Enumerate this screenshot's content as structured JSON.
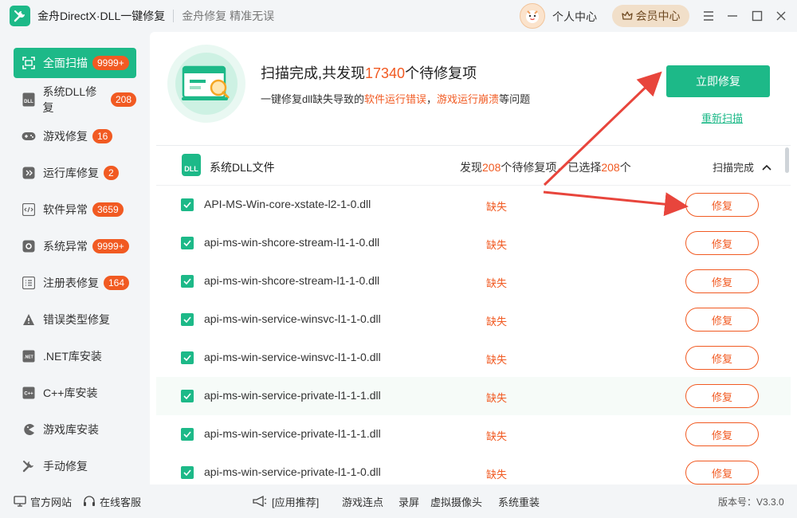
{
  "titlebar": {
    "app_name": "金舟DirectX·DLL一键修复",
    "slogan": "金舟修复 精准无误",
    "personal_center": "个人中心",
    "vip_center": "会员中心"
  },
  "sidebar": {
    "items": [
      {
        "label": "全面扫描",
        "badge": "9999+",
        "icon": "scan-icon",
        "active": true
      },
      {
        "label": "系统DLL修复",
        "badge": "208",
        "icon": "dll-icon"
      },
      {
        "label": "游戏修复",
        "badge": "16",
        "icon": "gamepad-icon"
      },
      {
        "label": "运行库修复",
        "badge": "2",
        "icon": "runtime-icon"
      },
      {
        "label": "软件异常",
        "badge": "3659",
        "icon": "code-icon"
      },
      {
        "label": "系统异常",
        "badge": "9999+",
        "icon": "gear-icon"
      },
      {
        "label": "注册表修复",
        "badge": "164",
        "icon": "list-icon"
      },
      {
        "label": "错误类型修复",
        "badge": "",
        "icon": "warning-icon"
      },
      {
        "label": ".NET库安装",
        "badge": "",
        "icon": "dotnet-icon"
      },
      {
        "label": "C++库安装",
        "badge": "",
        "icon": "cpp-icon"
      },
      {
        "label": "游戏库安装",
        "badge": "",
        "icon": "pacman-icon"
      },
      {
        "label": "手动修复",
        "badge": "",
        "icon": "wrench-icon"
      }
    ]
  },
  "hero": {
    "title_prefix": "扫描完成,共发现",
    "count": "17340",
    "title_suffix": "个待修复项",
    "sub_prefix": "一键修复dll缺失导致的",
    "sub_hl1": "软件运行错误",
    "sub_sep": "，",
    "sub_hl2": "游戏运行崩溃",
    "sub_suffix": "等问题",
    "fix_now": "立即修复",
    "rescan": "重新扫描"
  },
  "list": {
    "title": "系统DLL文件",
    "dll_icon_text": "DLL",
    "found_prefix": "发现",
    "found_count": "208",
    "found_mid": "个待修复项，已选择",
    "selected_count": "208",
    "found_suffix": "个",
    "scan_status": "扫描完成",
    "rows": [
      {
        "name": "API-MS-Win-core-xstate-l2-1-0.dll",
        "status": "缺失",
        "action": "修复"
      },
      {
        "name": "api-ms-win-shcore-stream-l1-1-0.dll",
        "status": "缺失",
        "action": "修复"
      },
      {
        "name": "api-ms-win-shcore-stream-l1-1-0.dll",
        "status": "缺失",
        "action": "修复"
      },
      {
        "name": "api-ms-win-service-winsvc-l1-1-0.dll",
        "status": "缺失",
        "action": "修复"
      },
      {
        "name": "api-ms-win-service-winsvc-l1-1-0.dll",
        "status": "缺失",
        "action": "修复"
      },
      {
        "name": "api-ms-win-service-private-l1-1-1.dll",
        "status": "缺失",
        "action": "修复"
      },
      {
        "name": "api-ms-win-service-private-l1-1-1.dll",
        "status": "缺失",
        "action": "修复"
      },
      {
        "name": "api-ms-win-service-private-l1-1-0.dll",
        "status": "缺失",
        "action": "修复"
      }
    ]
  },
  "footer": {
    "website": "官方网站",
    "service": "在线客服",
    "recommend": "[应用推荐]",
    "links": [
      "游戏连点",
      "录屏",
      "虚拟摄像头",
      "系统重装"
    ],
    "version": "版本号：V3.3.0"
  },
  "colors": {
    "accent": "#1db988",
    "warning": "#f15a22",
    "annotation": "#e8453c"
  }
}
